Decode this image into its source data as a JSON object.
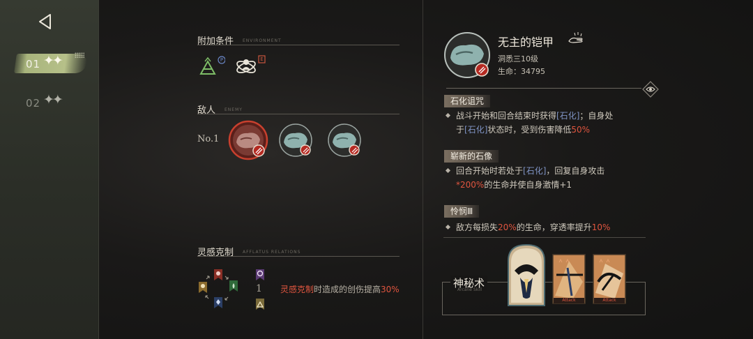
{
  "stages": [
    {
      "num": "01",
      "stars": "✦✦",
      "active": true
    },
    {
      "num": "02",
      "stars": "✦✦",
      "active": false
    }
  ],
  "environment": {
    "title": "附加条件",
    "subtitle": "ENVIRONMENT",
    "badge1": "P",
    "badge2": "E"
  },
  "enemy": {
    "title": "敌人",
    "subtitle": "ENEMY",
    "label": "No.1"
  },
  "afflatus": {
    "title": "灵感克制",
    "subtitle": "AFFLATUS RELATIONS",
    "center_mark": "1",
    "desc_highlight": "灵感克制",
    "desc_mid": "时造成的创伤提高",
    "desc_pct": "30%"
  },
  "boss": {
    "name": "无主的铠甲",
    "insight": "洞悉三10级",
    "hp_label": "生命：",
    "hp_value": "34795"
  },
  "skills": [
    {
      "name": "石化诅咒",
      "p1": "战斗开始和回合结束时获得",
      "b1": "[石化]",
      "p2": "；自身处",
      "p3": "于",
      "b2": "[石化]",
      "p4": "状态时，受到伤害降低",
      "r1": "50%"
    },
    {
      "name": "崭新的石像",
      "p1": "回合开始时若处于",
      "b1": "[石化]",
      "p2": "，回复自身攻击",
      "r1": "*200%",
      "p3": "的生命并使自身激情+1"
    },
    {
      "name": "怜悯Ⅲ",
      "p1": "敌方每损失",
      "r1": "20%",
      "p2": "的生命，穿透率提升",
      "r2": "10%"
    }
  ],
  "mystery": {
    "title": "神秘术",
    "subtitle": "Arcane Skill",
    "card_label": "Attack"
  },
  "colors": {
    "accent_red": "#e0553f",
    "status_blue": "#7f93c4",
    "stage_green": "#b6c089"
  }
}
